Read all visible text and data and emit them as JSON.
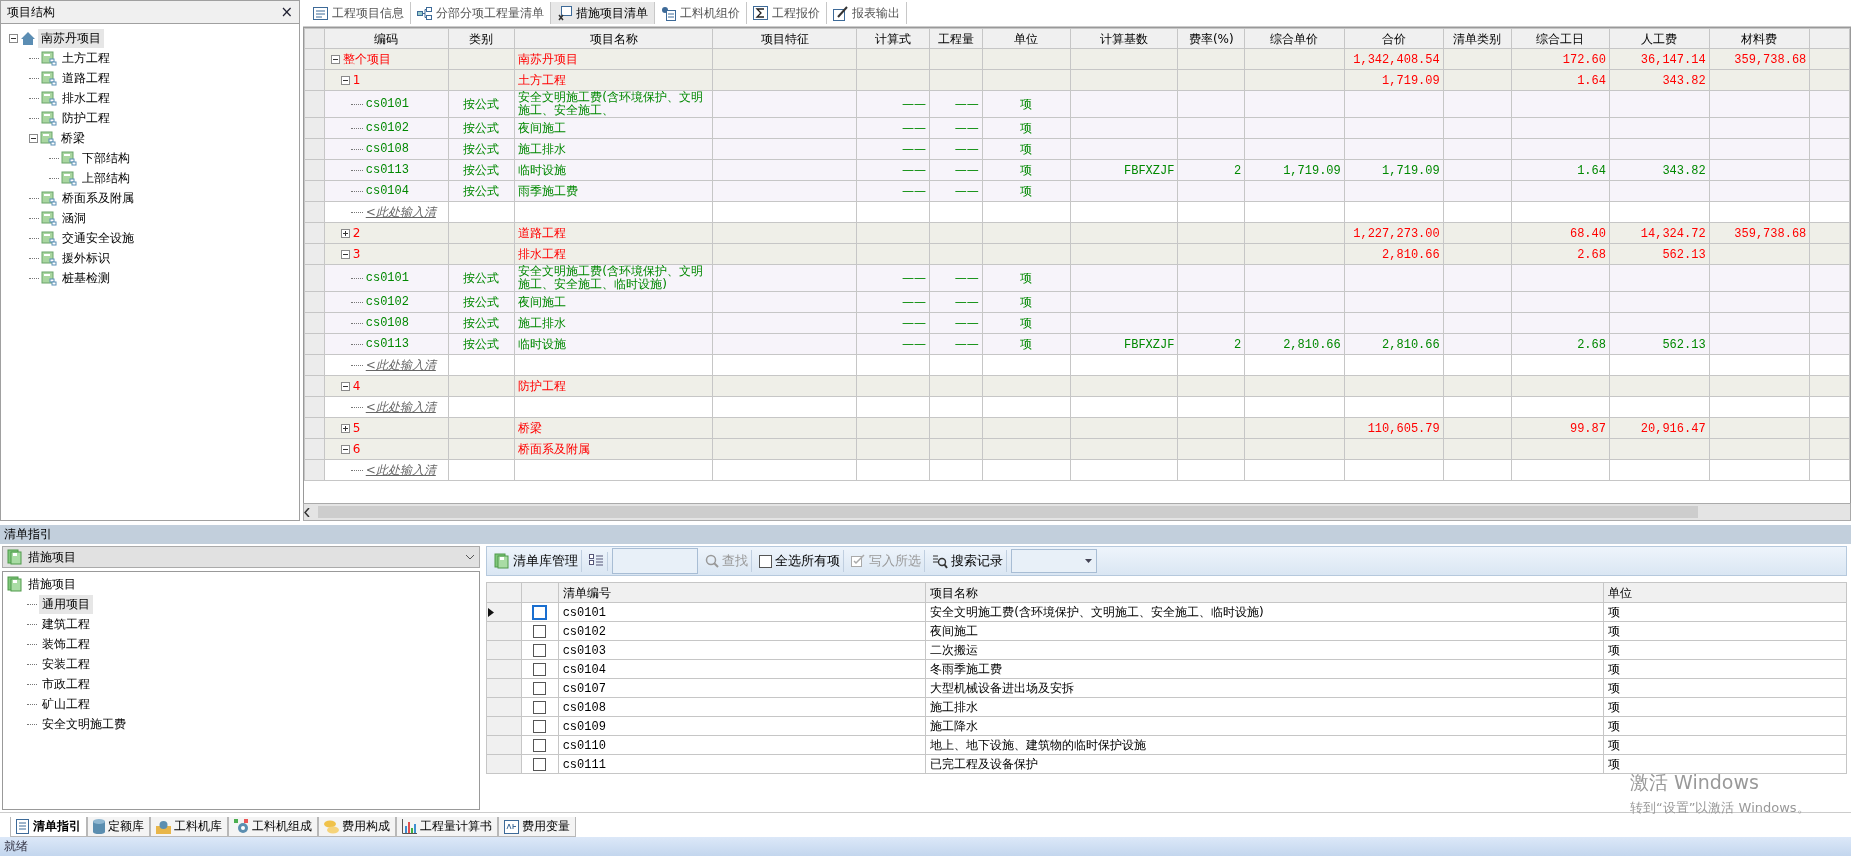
{
  "structure": {
    "title": "项目结构",
    "close": "×",
    "items": [
      {
        "label": "南苏丹项目",
        "selected": true,
        "expanded": true,
        "children": [
          {
            "label": "土方工程",
            "selected": false
          },
          {
            "label": "道路工程",
            "selected": false
          },
          {
            "label": "排水工程",
            "selected": false
          },
          {
            "label": "防护工程",
            "selected": false
          },
          {
            "label": "桥梁",
            "selected": false,
            "expanded": true,
            "children": [
              {
                "label": "下部结构",
                "selected": false
              },
              {
                "label": "上部结构",
                "selected": false
              }
            ]
          },
          {
            "label": "桥面系及附属",
            "selected": false
          },
          {
            "label": "涵洞",
            "selected": false
          },
          {
            "label": "交通安全设施",
            "selected": false
          },
          {
            "label": "援外标识",
            "selected": false
          },
          {
            "label": "桩基检测",
            "selected": false
          }
        ]
      }
    ]
  },
  "tabs": [
    {
      "label": "工程项目信息",
      "selected": false
    },
    {
      "label": "分部分项工程量清单",
      "selected": false
    },
    {
      "label": "措施项目清单",
      "selected": true
    },
    {
      "label": "工料机组价",
      "selected": false
    },
    {
      "label": "工程报价",
      "selected": false
    },
    {
      "label": "报表输出",
      "selected": false
    }
  ],
  "table": {
    "columns": [
      "编码",
      "类别",
      "项目名称",
      "项目特征",
      "计算式",
      "工程量",
      "单位",
      "计算基数",
      "费率(%)",
      "综合单价",
      "合价",
      "清单类别",
      "综合工日",
      "人工费",
      "材料费"
    ],
    "rows": [
      {
        "kind": "group",
        "code": "整个项目",
        "name": "南苏丹项目",
        "total": "1,342,408.54",
        "labor_days": "172.60",
        "labor_cost": "36,147.14",
        "material_cost": "359,738.68",
        "expanded": true,
        "children": [
          {
            "kind": "group",
            "code": "1",
            "name": "土方工程",
            "total": "1,719.09",
            "labor_days": "1.64",
            "labor_cost": "343.82",
            "expanded": true,
            "children": [
              {
                "kind": "item",
                "code": "cs0101",
                "category": "按公式",
                "name": "安全文明施工费(含环境保护、文明施工、安全施工、",
                "formula": "——",
                "quantity": "——",
                "unit": "项"
              },
              {
                "kind": "item",
                "code": "cs0102",
                "category": "按公式",
                "name": "夜间施工",
                "formula": "——",
                "quantity": "——",
                "unit": "项"
              },
              {
                "kind": "item",
                "code": "cs0108",
                "category": "按公式",
                "name": "施工排水",
                "formula": "——",
                "quantity": "——",
                "unit": "项"
              },
              {
                "kind": "item",
                "code": "cs0113",
                "category": "按公式",
                "name": "临时设施",
                "formula": "——",
                "quantity": "——",
                "unit": "项",
                "base": "FBFXZJF",
                "rate": "2",
                "unit_price": "1,719.09",
                "total": "1,719.09",
                "labor_days": "1.64",
                "labor_cost": "343.82"
              },
              {
                "kind": "item",
                "code": "cs0104",
                "category": "按公式",
                "name": "雨季施工费",
                "formula": "——",
                "quantity": "——",
                "unit": "项"
              },
              {
                "kind": "input",
                "code": "<此处输入清"
              }
            ]
          },
          {
            "kind": "group",
            "code": "2",
            "name": "道路工程",
            "total": "1,227,273.00",
            "labor_days": "68.40",
            "labor_cost": "14,324.72",
            "material_cost": "359,738.68",
            "expanded": false
          },
          {
            "kind": "group",
            "code": "3",
            "name": "排水工程",
            "total": "2,810.66",
            "labor_days": "2.68",
            "labor_cost": "562.13",
            "expanded": true,
            "children": [
              {
                "kind": "item",
                "code": "cs0101",
                "category": "按公式",
                "name": "安全文明施工费(含环境保护、文明施工、安全施工、临时设施)",
                "formula": "——",
                "quantity": "——",
                "unit": "项"
              },
              {
                "kind": "item",
                "code": "cs0102",
                "category": "按公式",
                "name": "夜间施工",
                "formula": "——",
                "quantity": "——",
                "unit": "项"
              },
              {
                "kind": "item",
                "code": "cs0108",
                "category": "按公式",
                "name": "施工排水",
                "formula": "——",
                "quantity": "——",
                "unit": "项"
              },
              {
                "kind": "item",
                "code": "cs0113",
                "category": "按公式",
                "name": "临时设施",
                "formula": "——",
                "quantity": "——",
                "unit": "项",
                "base": "FBFXZJF",
                "rate": "2",
                "unit_price": "2,810.66",
                "total": "2,810.66",
                "labor_days": "2.68",
                "labor_cost": "562.13"
              },
              {
                "kind": "input",
                "code": "<此处输入清"
              }
            ]
          },
          {
            "kind": "group",
            "code": "4",
            "name": "防护工程",
            "expanded": true,
            "children": [
              {
                "kind": "input",
                "code": "<此处输入清"
              }
            ]
          },
          {
            "kind": "group",
            "code": "5",
            "name": "桥梁",
            "total": "110,605.79",
            "labor_days": "99.87",
            "labor_cost": "20,916.47",
            "expanded": false
          },
          {
            "kind": "group",
            "code": "6",
            "name": "桥面系及附属",
            "expanded": true,
            "children": [
              {
                "kind": "input",
                "code": "<此处输入清"
              }
            ]
          }
        ]
      }
    ]
  },
  "guide": {
    "title": "清单指引",
    "library": "措施项目",
    "tree": [
      {
        "label": "措施项目",
        "selected": false,
        "children": [
          {
            "label": "通用项目",
            "selected": true
          },
          {
            "label": "建筑工程",
            "selected": false
          },
          {
            "label": "装饰工程",
            "selected": false
          },
          {
            "label": "安装工程",
            "selected": false
          },
          {
            "label": "市政工程",
            "selected": false
          },
          {
            "label": "矿山工程",
            "selected": false
          },
          {
            "label": "安全文明施工费",
            "selected": false
          }
        ]
      }
    ],
    "toolbar": [
      {
        "kind": "button",
        "label": "清单库管理",
        "disabled": false
      },
      {
        "kind": "icon_button"
      },
      {
        "kind": "field"
      },
      {
        "kind": "button",
        "label": "查找",
        "disabled": true
      },
      {
        "kind": "checkbox",
        "label": "全选所有项",
        "checked": false
      },
      {
        "kind": "button",
        "label": "写入所选",
        "disabled": true
      },
      {
        "kind": "button",
        "label": "搜索记录",
        "disabled": false
      },
      {
        "kind": "dropdown"
      }
    ],
    "grid": {
      "columns": [
        "清单编号",
        "项目名称",
        "单位"
      ],
      "rows": [
        {
          "code": "cs0101",
          "name": "安全文明施工费(含环境保护、文明施工、安全施工、临时设施)",
          "unit": "项",
          "selected": true,
          "checked": false
        },
        {
          "code": "cs0102",
          "name": "夜间施工",
          "unit": "项",
          "selected": false,
          "checked": false
        },
        {
          "code": "cs0103",
          "name": "二次搬运",
          "unit": "项",
          "selected": false,
          "checked": false
        },
        {
          "code": "cs0104",
          "name": "冬雨季施工费",
          "unit": "项",
          "selected": false,
          "checked": false
        },
        {
          "code": "cs0107",
          "name": "大型机械设备进出场及安拆",
          "unit": "项",
          "selected": false,
          "checked": false
        },
        {
          "code": "cs0108",
          "name": "施工排水",
          "unit": "项",
          "selected": false,
          "checked": false
        },
        {
          "code": "cs0109",
          "name": "施工降水",
          "unit": "项",
          "selected": false,
          "checked": false
        },
        {
          "code": "cs0110",
          "name": "地上、地下设施、建筑物的临时保护设施",
          "unit": "项",
          "selected": false,
          "checked": false
        },
        {
          "code": "cs0111",
          "name": "已完工程及设备保护",
          "unit": "项",
          "selected": false,
          "checked": false
        }
      ]
    }
  },
  "bottom_tabs": [
    {
      "label": "清单指引",
      "selected": true
    },
    {
      "label": "定额库",
      "selected": false
    },
    {
      "label": "工料机库",
      "selected": false
    },
    {
      "label": "工料机组成",
      "selected": false
    },
    {
      "label": "费用构成",
      "selected": false
    },
    {
      "label": "工程量计算书",
      "selected": false
    },
    {
      "label": "费用变量",
      "selected": false
    }
  ],
  "status_bar": "就绪",
  "activation_notice": {
    "title": "激活 Windows",
    "subtitle": "转到“设置”以激活 Windows。"
  }
}
